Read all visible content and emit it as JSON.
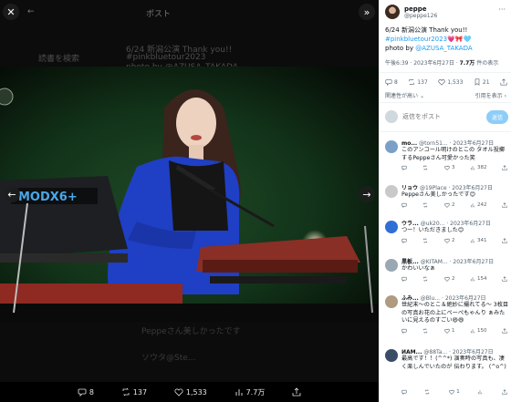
{
  "viewer": {
    "ghost_header": "ポスト",
    "ghost_line1": "6/24 新潟公演 Thank you!!",
    "ghost_line2": "#pinkbluetour2023",
    "ghost_line3": "photo by @AZUSA_TAKADA",
    "ghost_user": "Peppeさん美しかったです",
    "ghost_reply": "ソウタ@Ste...",
    "ghost_search": "読書を検索",
    "keyboard_brand": "MODX6+",
    "bottom": {
      "replies": "8",
      "reposts": "137",
      "likes": "1,533",
      "views": "7.7万"
    }
  },
  "tweet": {
    "display_name": "peppe",
    "handle": "@peppe126",
    "line1": "6/24 新潟公演 Thank you!!",
    "hashtag": "#pinkbluetour2023",
    "emoji": "💗🎀🩵",
    "photo_by": "photo by ",
    "photo_handle": "@AZUSA_TAKADA",
    "time": "午後6:39 · 2023年6月27日 · ",
    "views": "7.7万",
    "views_suffix": " 件の表示",
    "actions": {
      "replies": "8",
      "reposts": "137",
      "likes": "1,533",
      "bookmarks": "21"
    },
    "relevant": "関連性が高い",
    "quotes": "引用を表示"
  },
  "reply_box": {
    "placeholder": "返信をポスト",
    "button": "返信"
  },
  "replies": [
    {
      "name": "mo...",
      "handle": "@torn51...",
      "date": "2023年6月27日",
      "text": "このアンコール明けのとこの タオル投擲するPeppeさん可愛かった笑",
      "reposts": "",
      "likes": "3",
      "views": "382",
      "color": "#7aa0c8"
    },
    {
      "name": "リョウ",
      "handle": "@19Place",
      "date": "2023年6月27日",
      "text": "Peppeさん美しかったです😊",
      "reposts": "",
      "likes": "2",
      "views": "242",
      "color": "#c9c9c9"
    },
    {
      "name": "ウラ...",
      "handle": "@uk20...",
      "date": "2023年6月27日",
      "text": "つー！いただきました😊",
      "reposts": "",
      "likes": "2",
      "views": "341",
      "color": "#2f6fd6"
    },
    {
      "name": "黒板...",
      "handle": "@KITAM...",
      "date": "2023年6月27日",
      "text": "かわいいなぁ",
      "reposts": "",
      "likes": "2",
      "views": "154",
      "color": "#9aa8b3"
    },
    {
      "name": "ふみ...",
      "handle": "@Blu...",
      "date": "2023年6月27日",
      "text": "世紀末〜のとこ＆絶妙に撮れてる〜 3枚目の写真お花の上にぺーぺもゃんり ぁみたいに見えるのすごい😄😄",
      "reposts": "",
      "likes": "1",
      "views": "150",
      "color": "#b09a80"
    },
    {
      "name": "ИАМ...",
      "handle": "@88Ta...",
      "date": "2023年6月27日",
      "text": "最高です！！(^^*) 演奏時の写真も、凄く楽しんでいたのが 伝わります。 (^o^)",
      "reposts": "",
      "likes": "1",
      "views": "",
      "color": "#3a4c66"
    }
  ],
  "icons": {
    "close": "close-icon",
    "expand": "expand-icon",
    "prev": "arrow-left-icon",
    "next": "arrow-right-icon"
  }
}
